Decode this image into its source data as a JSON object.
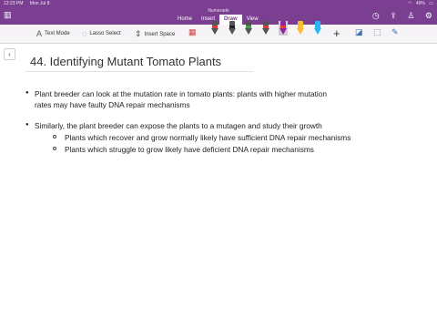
{
  "status_bar": {
    "time": "12:23 PM",
    "date": "Mon Jul 8",
    "battery": "49%"
  },
  "app": {
    "title": "Numerade"
  },
  "tabs": [
    {
      "label": "Home"
    },
    {
      "label": "Insert"
    },
    {
      "label": "Draw",
      "active": true
    },
    {
      "label": "View"
    }
  ],
  "toolbar": {
    "text_mode": "Text Mode",
    "lasso_select": "Lasso Select",
    "insert_space": "Insert Space",
    "pen_colors": [
      "#e53935",
      "#222222",
      "#43a047",
      "#e53935",
      "#8e24aa",
      "#e53935",
      "#fbc02d",
      "#29b6f6"
    ]
  },
  "page": {
    "title": "44. Identifying Mutant Tomato Plants",
    "bullets": [
      {
        "lines": [
          "Plant breeder can look at the mutation rate in tomato plants: plants with higher mutation",
          "rates may have faulty DNA repair mechanisms"
        ]
      },
      {
        "lines": [
          "Similarly, the plant breeder can expose the plants to a mutagen and study their growth"
        ],
        "sub": [
          "Plants which recover and grow normally likely have sufficient DNA repair mechanisms",
          "Plants which struggle to grow likely have deficient DNA repair mechanisms"
        ]
      }
    ]
  },
  "colors": {
    "header": "#7b3f91",
    "toolbar": "#f6f4f7"
  }
}
